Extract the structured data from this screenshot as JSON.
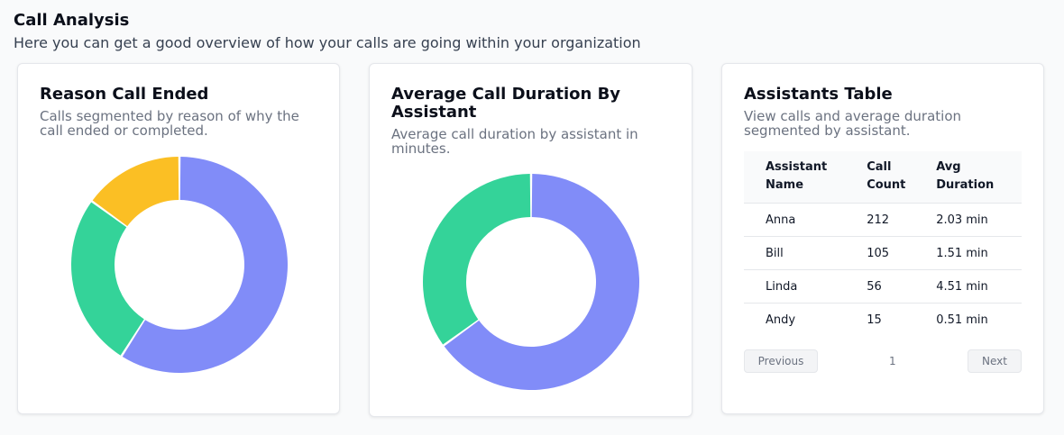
{
  "page": {
    "title": "Call Analysis",
    "subtitle": "Here you can get a good overview of how your calls are going within your organization"
  },
  "reason_card": {
    "title": "Reason Call Ended",
    "description": "Calls segmented by reason of why the call ended or completed."
  },
  "duration_card": {
    "title": "Average Call Duration By Assistant",
    "description": "Average call duration by assistant in minutes."
  },
  "table_card": {
    "title": "Assistants Table",
    "description": "View calls and average duration segmented by assistant.",
    "headers": [
      "Assistant Name",
      "Call Count",
      "Avg Duration"
    ],
    "rows": [
      [
        "Anna",
        "212",
        "2.03 min"
      ],
      [
        "Bill",
        "105",
        "1.51 min"
      ],
      [
        "Linda",
        "56",
        "4.51 min"
      ],
      [
        "Andy",
        "15",
        "0.51 min"
      ]
    ],
    "pager": {
      "previous": "Previous",
      "page": "1",
      "next": "Next"
    }
  },
  "colors": {
    "purple": "#818cf8",
    "green": "#34d399",
    "yellow": "#fbbf24"
  },
  "chart_data": [
    {
      "type": "pie",
      "variant": "donut",
      "values": [
        0.59,
        0.26,
        0.15
      ],
      "colors": [
        "#818cf8",
        "#34d399",
        "#fbbf24"
      ]
    },
    {
      "type": "pie",
      "variant": "donut",
      "values": [
        0.65,
        0.35
      ],
      "colors": [
        "#818cf8",
        "#34d399"
      ]
    }
  ]
}
